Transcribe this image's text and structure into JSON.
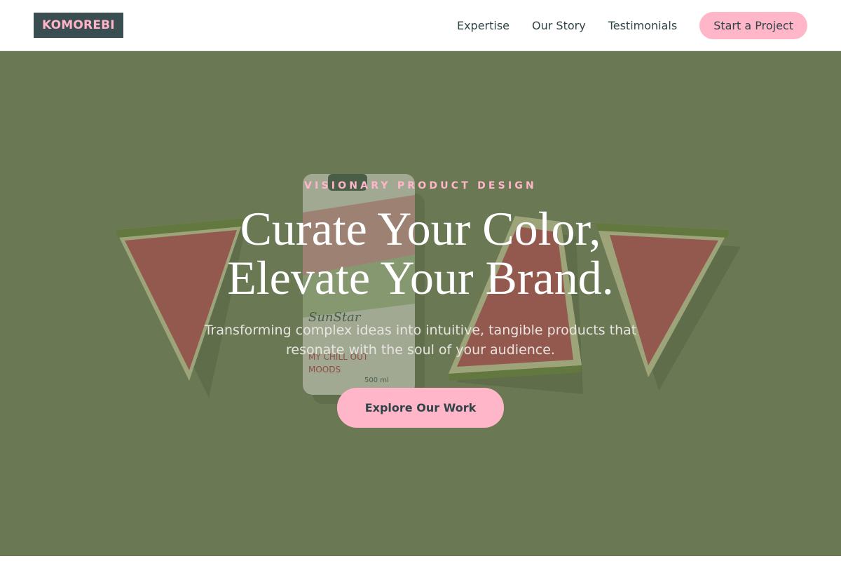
{
  "header": {
    "logo": "KOMOREBI",
    "nav": [
      {
        "label": "Expertise"
      },
      {
        "label": "Our Story"
      },
      {
        "label": "Testimonials"
      }
    ],
    "cta_label": "Start a Project"
  },
  "hero": {
    "eyebrow": "VISIONARY PRODUCT DESIGN",
    "headline_line1": "Curate Your Color,",
    "headline_line2": "Elevate Your Brand.",
    "subhead": "Transforming complex ideas into intuitive, tangible products that resonate with the soul of your audience.",
    "cta_label": "Explore Our Work",
    "image": {
      "description_icon": "watermelon-bottle-photo",
      "bottle_brand": "SunStar",
      "bottle_tagline": "MY CHILL OUT MOODS",
      "bottle_volume": "500 ml"
    }
  },
  "colors": {
    "accent_pink": "#ffb6c9",
    "logo_bg": "#3a4e52",
    "text_dark": "#2f4447",
    "hero_bg": "#6b7651"
  }
}
